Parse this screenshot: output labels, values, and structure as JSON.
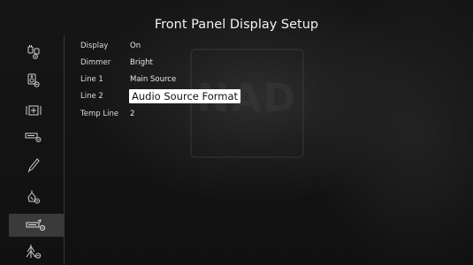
{
  "screen": {
    "title": "Front Panel Display Setup",
    "watermark": "NAD"
  },
  "sidebar": {
    "items": [
      {
        "icon": "input-config-icon"
      },
      {
        "icon": "speaker-setup-icon"
      },
      {
        "icon": "listening-mode-icon"
      },
      {
        "icon": "amp-setup-icon"
      },
      {
        "icon": "pen-settings-icon"
      },
      {
        "icon": "zone-setup-icon"
      },
      {
        "icon": "display-setup-icon",
        "selected": true
      },
      {
        "icon": "audio-setup-icon"
      }
    ]
  },
  "settings": [
    {
      "label": "Display",
      "value": "On"
    },
    {
      "label": "Dimmer",
      "value": "Bright"
    },
    {
      "label": "Line 1",
      "value": "Main Source"
    },
    {
      "label": "Line 2",
      "value": "Audio Source Format",
      "active": true
    },
    {
      "label": "Temp Line",
      "value": "2"
    }
  ]
}
